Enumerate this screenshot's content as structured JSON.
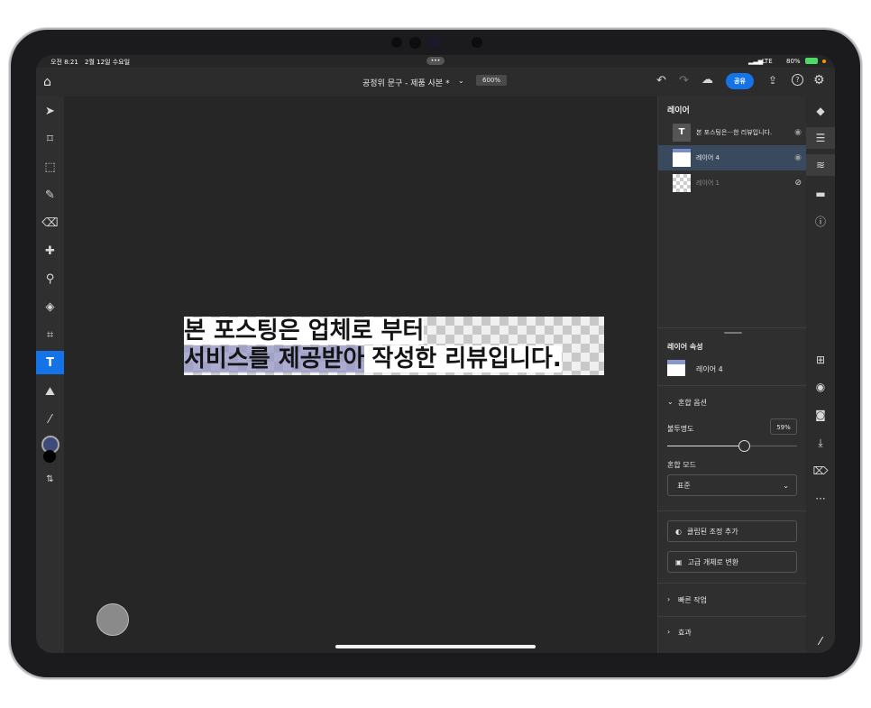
{
  "status": {
    "time": "오전 8:21",
    "date": "2월 12일 수요일",
    "network": "LTE",
    "battery": "80%"
  },
  "topbar": {
    "doc_title": "공정위 문구 - 제품 사본 *",
    "zoom": "600%",
    "share_label": "공유",
    "more_dots": "•••"
  },
  "tools": {
    "active": "type-tool",
    "type_label": "T"
  },
  "canvas": {
    "line1": "본 포스팅은 업체로 부터",
    "line2_a": "서비스를 제공받아",
    "line2_b": "작성한 리뷰입니다."
  },
  "layers_panel": {
    "title": "레이어",
    "layers": [
      {
        "name": "본 포스팅은···한 리뷰입니다.",
        "visible": true,
        "type": "text"
      },
      {
        "name": "레이어 4",
        "visible": true,
        "selected": true
      },
      {
        "name": "레이어 1",
        "visible": false
      }
    ]
  },
  "properties_panel": {
    "title": "레이어 속성",
    "layer_name": "레이어 4",
    "blend_options_label": "혼합 옵션",
    "opacity_label": "불투명도",
    "opacity_value": "59%",
    "opacity_fraction": 0.59,
    "blend_mode_label": "혼합 모드",
    "blend_mode_value": "표준",
    "clipped_adjust_label": "클립된 조정 추가",
    "smart_object_label": "고급 개체로 변환",
    "quick_actions_label": "빠른 작업",
    "effects_label": "효과"
  },
  "colors": {
    "accent": "#1473e6",
    "foreground_swatch": "#3d4a7a",
    "background_swatch": "#000000"
  }
}
